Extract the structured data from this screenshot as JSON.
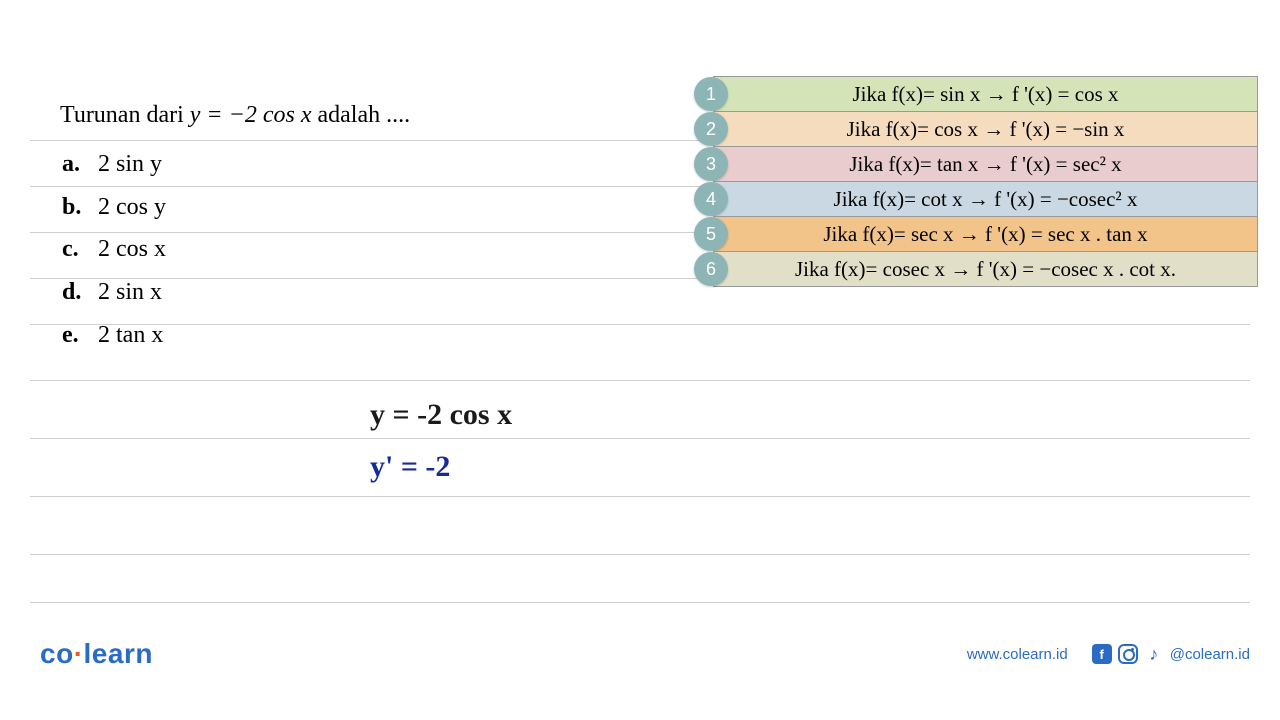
{
  "question": {
    "prompt_prefix": "Turunan dari ",
    "equation": "y = −2 cos x",
    "prompt_suffix": " adalah ....",
    "options": [
      {
        "label": "a.",
        "text": "2 sin y"
      },
      {
        "label": "b.",
        "text": "2 cos y"
      },
      {
        "label": "c.",
        "text": "2 cos x"
      },
      {
        "label": "d.",
        "text": "2 sin x"
      },
      {
        "label": "e.",
        "text": "2 tan x"
      }
    ]
  },
  "rules": [
    {
      "n": "1",
      "text": "Jika f(x)= sin x → f '(x) = cos x"
    },
    {
      "n": "2",
      "text": "Jika f(x)= cos x → f '(x) = −sin x"
    },
    {
      "n": "3",
      "text": "Jika f(x)= tan x → f '(x) = sec² x"
    },
    {
      "n": "4",
      "text": "Jika f(x)= cot x → f '(x) = −cosec² x"
    },
    {
      "n": "5",
      "text": "Jika f(x)= sec x → f '(x) = sec x . tan x"
    },
    {
      "n": "6",
      "text": "Jika f(x)= cosec x → f '(x) = −cosec x . cot x."
    }
  ],
  "handwriting": {
    "line1": "y = -2 cos x",
    "line2": "y' = -2"
  },
  "footer": {
    "logo_left": "co",
    "logo_right": "learn",
    "url": "www.colearn.id",
    "handle": "@colearn.id"
  }
}
